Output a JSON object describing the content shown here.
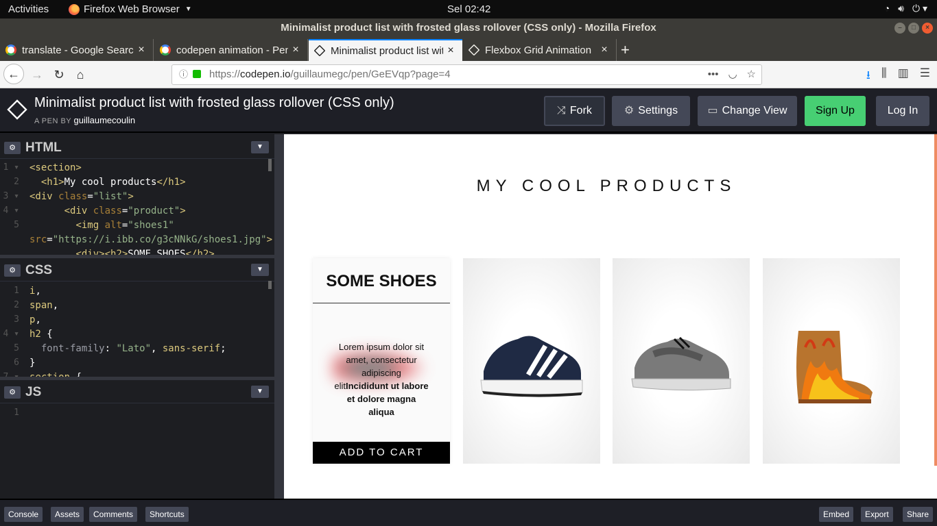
{
  "topbar": {
    "activities": "Activities",
    "app_name": "Firefox Web Browser",
    "clock": "Sel 02:42"
  },
  "window": {
    "title": "Minimalist product list with frosted glass rollover (CSS only) - Mozilla Firefox"
  },
  "tabs": [
    {
      "label": "translate - Google Search",
      "icon": "google-icon"
    },
    {
      "label": "codepen animation - Pen",
      "icon": "google-icon"
    },
    {
      "label": "Minimalist product list with frosted glass rollover",
      "icon": "codepen-icon",
      "active": true
    },
    {
      "label": "Flexbox Grid Animation",
      "icon": "codepen-icon"
    }
  ],
  "urlbar": {
    "prefix": "https://",
    "domain": "codepen.io",
    "path": "/guillaumegc/pen/GeEVqp?page=4"
  },
  "codepen": {
    "pen_title": "Minimalist product list with frosted glass rollover (CSS only)",
    "by_label": "A PEN BY",
    "author": "guillaumecoulin",
    "buttons": {
      "fork": "Fork",
      "settings": "Settings",
      "change_view": "Change View",
      "signup": "Sign Up",
      "login": "Log In"
    }
  },
  "editors": {
    "html": {
      "name": "HTML"
    },
    "css": {
      "name": "CSS"
    },
    "js": {
      "name": "JS"
    }
  },
  "preview": {
    "heading": "MY COOL PRODUCTS",
    "card": {
      "title": "SOME SHOES",
      "text_normal": "Lorem ipsum dolor sit amet, consectetur adipiscing elit",
      "text_bold": "Incididunt ut labore et dolore magna aliqua",
      "cart": "ADD TO CART"
    },
    "products": [
      "navy-adidas-sneaker",
      "grey-reebok-sneaker",
      "flame-boot"
    ]
  },
  "footer": {
    "left": [
      "Console",
      "Assets",
      "Comments",
      "Shortcuts"
    ],
    "right": [
      "Embed",
      "Export",
      "Share"
    ]
  },
  "colors": {
    "signup": "#47cf73",
    "tab_accent": "#0a84ff",
    "preview_scroll": "#ef8c63"
  }
}
